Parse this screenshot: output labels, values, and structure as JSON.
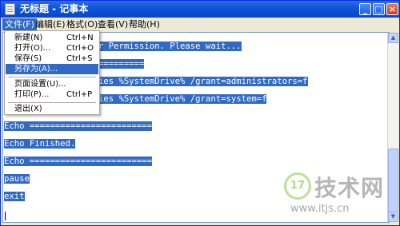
{
  "window": {
    "title": "无标题 - 记事本",
    "minimize_glyph": "_",
    "maximize_glyph": "□",
    "close_glyph": "×"
  },
  "menubar": {
    "items": [
      {
        "label": "文件(F)"
      },
      {
        "label": "编辑(E)"
      },
      {
        "label": "格式(O)"
      },
      {
        "label": "查看(V)"
      },
      {
        "label": "帮助(H)"
      }
    ]
  },
  "file_menu": {
    "items": [
      {
        "label": "新建(N)",
        "shortcut": "Ctrl+N"
      },
      {
        "label": "打开(O)...",
        "shortcut": "Ctrl+O"
      },
      {
        "label": "保存(S)",
        "shortcut": "Ctrl+S"
      },
      {
        "label": "另存为(A)...",
        "shortcut": ""
      },
      {
        "label": "页面设置(U)...",
        "shortcut": ""
      },
      {
        "label": "打印(P)...",
        "shortcut": "Ctrl+P"
      },
      {
        "label": "退出(X)",
        "shortcut": ""
      }
    ]
  },
  "editor": {
    "lines": [
      "r Permission. Please wait...",
      "=========",
      "ies %SystemDrive% /grant=administrators=f",
      "ies %SystemDrive% /grant=system=f",
      "Echo ========================",
      "Echo Finished.",
      "Echo ========================",
      "pause",
      "exit"
    ]
  },
  "watermark": {
    "logo": "17",
    "text": "技术网",
    "url": "www.itjs.cn"
  },
  "colors": {
    "selection": "#316ac5",
    "titlebar": "#0d55d8"
  }
}
